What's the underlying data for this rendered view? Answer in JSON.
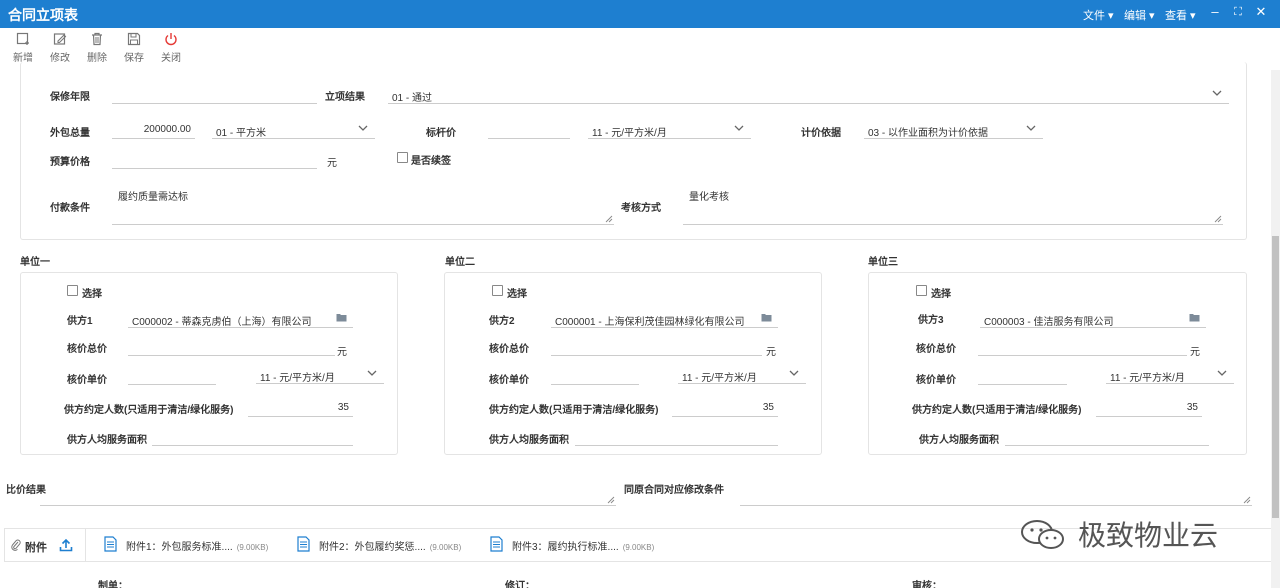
{
  "window": {
    "title": "合同立项表",
    "menus": [
      "文件",
      "编辑",
      "查看"
    ],
    "controls": [
      "–",
      "⛶",
      "✕"
    ]
  },
  "toolbar": {
    "new_label": "新增",
    "edit_label": "修改",
    "delete_label": "删除",
    "save_label": "保存",
    "close_label": "关闭"
  },
  "form": {
    "warranty_years": {
      "label": "保修年限",
      "value": ""
    },
    "approval_result": {
      "label": "立项结果",
      "value": "01 - 通过"
    },
    "outsourcing_total": {
      "label": "外包总量",
      "value": "200000.00",
      "unit_value": "01 - 平方米"
    },
    "benchmark_price": {
      "label": "标杆价",
      "value": "",
      "unit_value": "11 - 元/平方米/月"
    },
    "pricing_basis": {
      "label": "计价依据",
      "value": "03 - 以作业面积为计价依据"
    },
    "budget_price": {
      "label": "预算价格",
      "value": "",
      "unit": "元"
    },
    "renewal": {
      "label": "是否续签"
    },
    "payment_terms": {
      "label": "付款条件",
      "value": "履约质量需达标"
    },
    "assessment_method": {
      "label": "考核方式",
      "value": "量化考核"
    }
  },
  "units": [
    {
      "title": "单位一",
      "select_label": "选择",
      "supplier_label": "供方1",
      "supplier_value": "C000002 - 蒂森克虏伯（上海）有限公司",
      "total_label": "核价总价",
      "total_value": "",
      "total_unit": "元",
      "unit_price_label": "核价单价",
      "unit_price_value": "",
      "unit_price_unit": "11 - 元/平方米/月",
      "headcount_label": "供方约定人数(只适用于清洁/绿化服务)",
      "headcount_value": "35",
      "area_label": "供方人均服务面积",
      "area_value": ""
    },
    {
      "title": "单位二",
      "select_label": "选择",
      "supplier_label": "供方2",
      "supplier_value": "C000001 - 上海保利茂佳园林绿化有限公司",
      "total_label": "核价总价",
      "total_value": "",
      "total_unit": "元",
      "unit_price_label": "核价单价",
      "unit_price_value": "",
      "unit_price_unit": "11 - 元/平方米/月",
      "headcount_label": "供方约定人数(只适用于清洁/绿化服务)",
      "headcount_value": "35",
      "area_label": "供方人均服务面积",
      "area_value": ""
    },
    {
      "title": "单位三",
      "select_label": "选择",
      "supplier_label": "供方3",
      "supplier_value": "C000003 - 佳洁服务有限公司",
      "total_label": "核价总价",
      "total_value": "",
      "total_unit": "元",
      "unit_price_label": "核价单价",
      "unit_price_value": "",
      "unit_price_unit": "11 - 元/平方米/月",
      "headcount_label": "供方约定人数(只适用于清洁/绿化服务)",
      "headcount_value": "35",
      "area_label": "供方人均服务面积",
      "area_value": ""
    }
  ],
  "comparison": {
    "result_label": "比价结果",
    "result_value": "",
    "modify_label": "同原合同对应修改条件",
    "modify_value": ""
  },
  "attachments": {
    "label": "附件",
    "items": [
      {
        "name": "附件1：外包服务标准....",
        "size": "(9.00KB)"
      },
      {
        "name": "附件2：外包履约奖惩....",
        "size": "(9.00KB)"
      },
      {
        "name": "附件3：履约执行标准....",
        "size": "(9.00KB)"
      }
    ]
  },
  "footer": {
    "maker_label": "制单：",
    "revise_label": "修订：",
    "review_label": "审核："
  },
  "watermark": {
    "text": "极致物业云"
  },
  "colors": {
    "titlebar": "#1e7fd0",
    "close_icon": "#e53935",
    "attachment_icon": "#1e7fd0"
  }
}
